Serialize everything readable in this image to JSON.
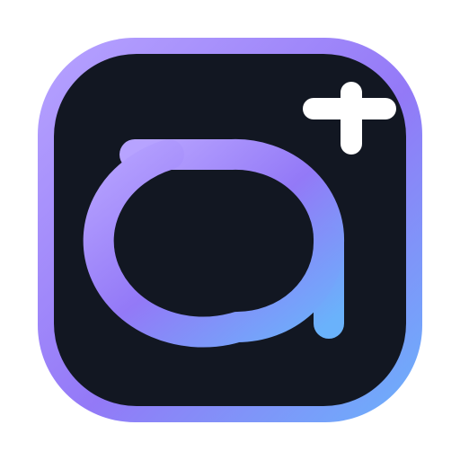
{
  "icon": {
    "name": "app-logo-with-plus",
    "colors": {
      "background": "#ffffff",
      "tile_fill": "#121722",
      "gradient_light_purple": "#B7A3FF",
      "gradient_purple": "#9379F7",
      "gradient_blue": "#6AB2FB",
      "plus_badge": "#ffffff"
    }
  }
}
